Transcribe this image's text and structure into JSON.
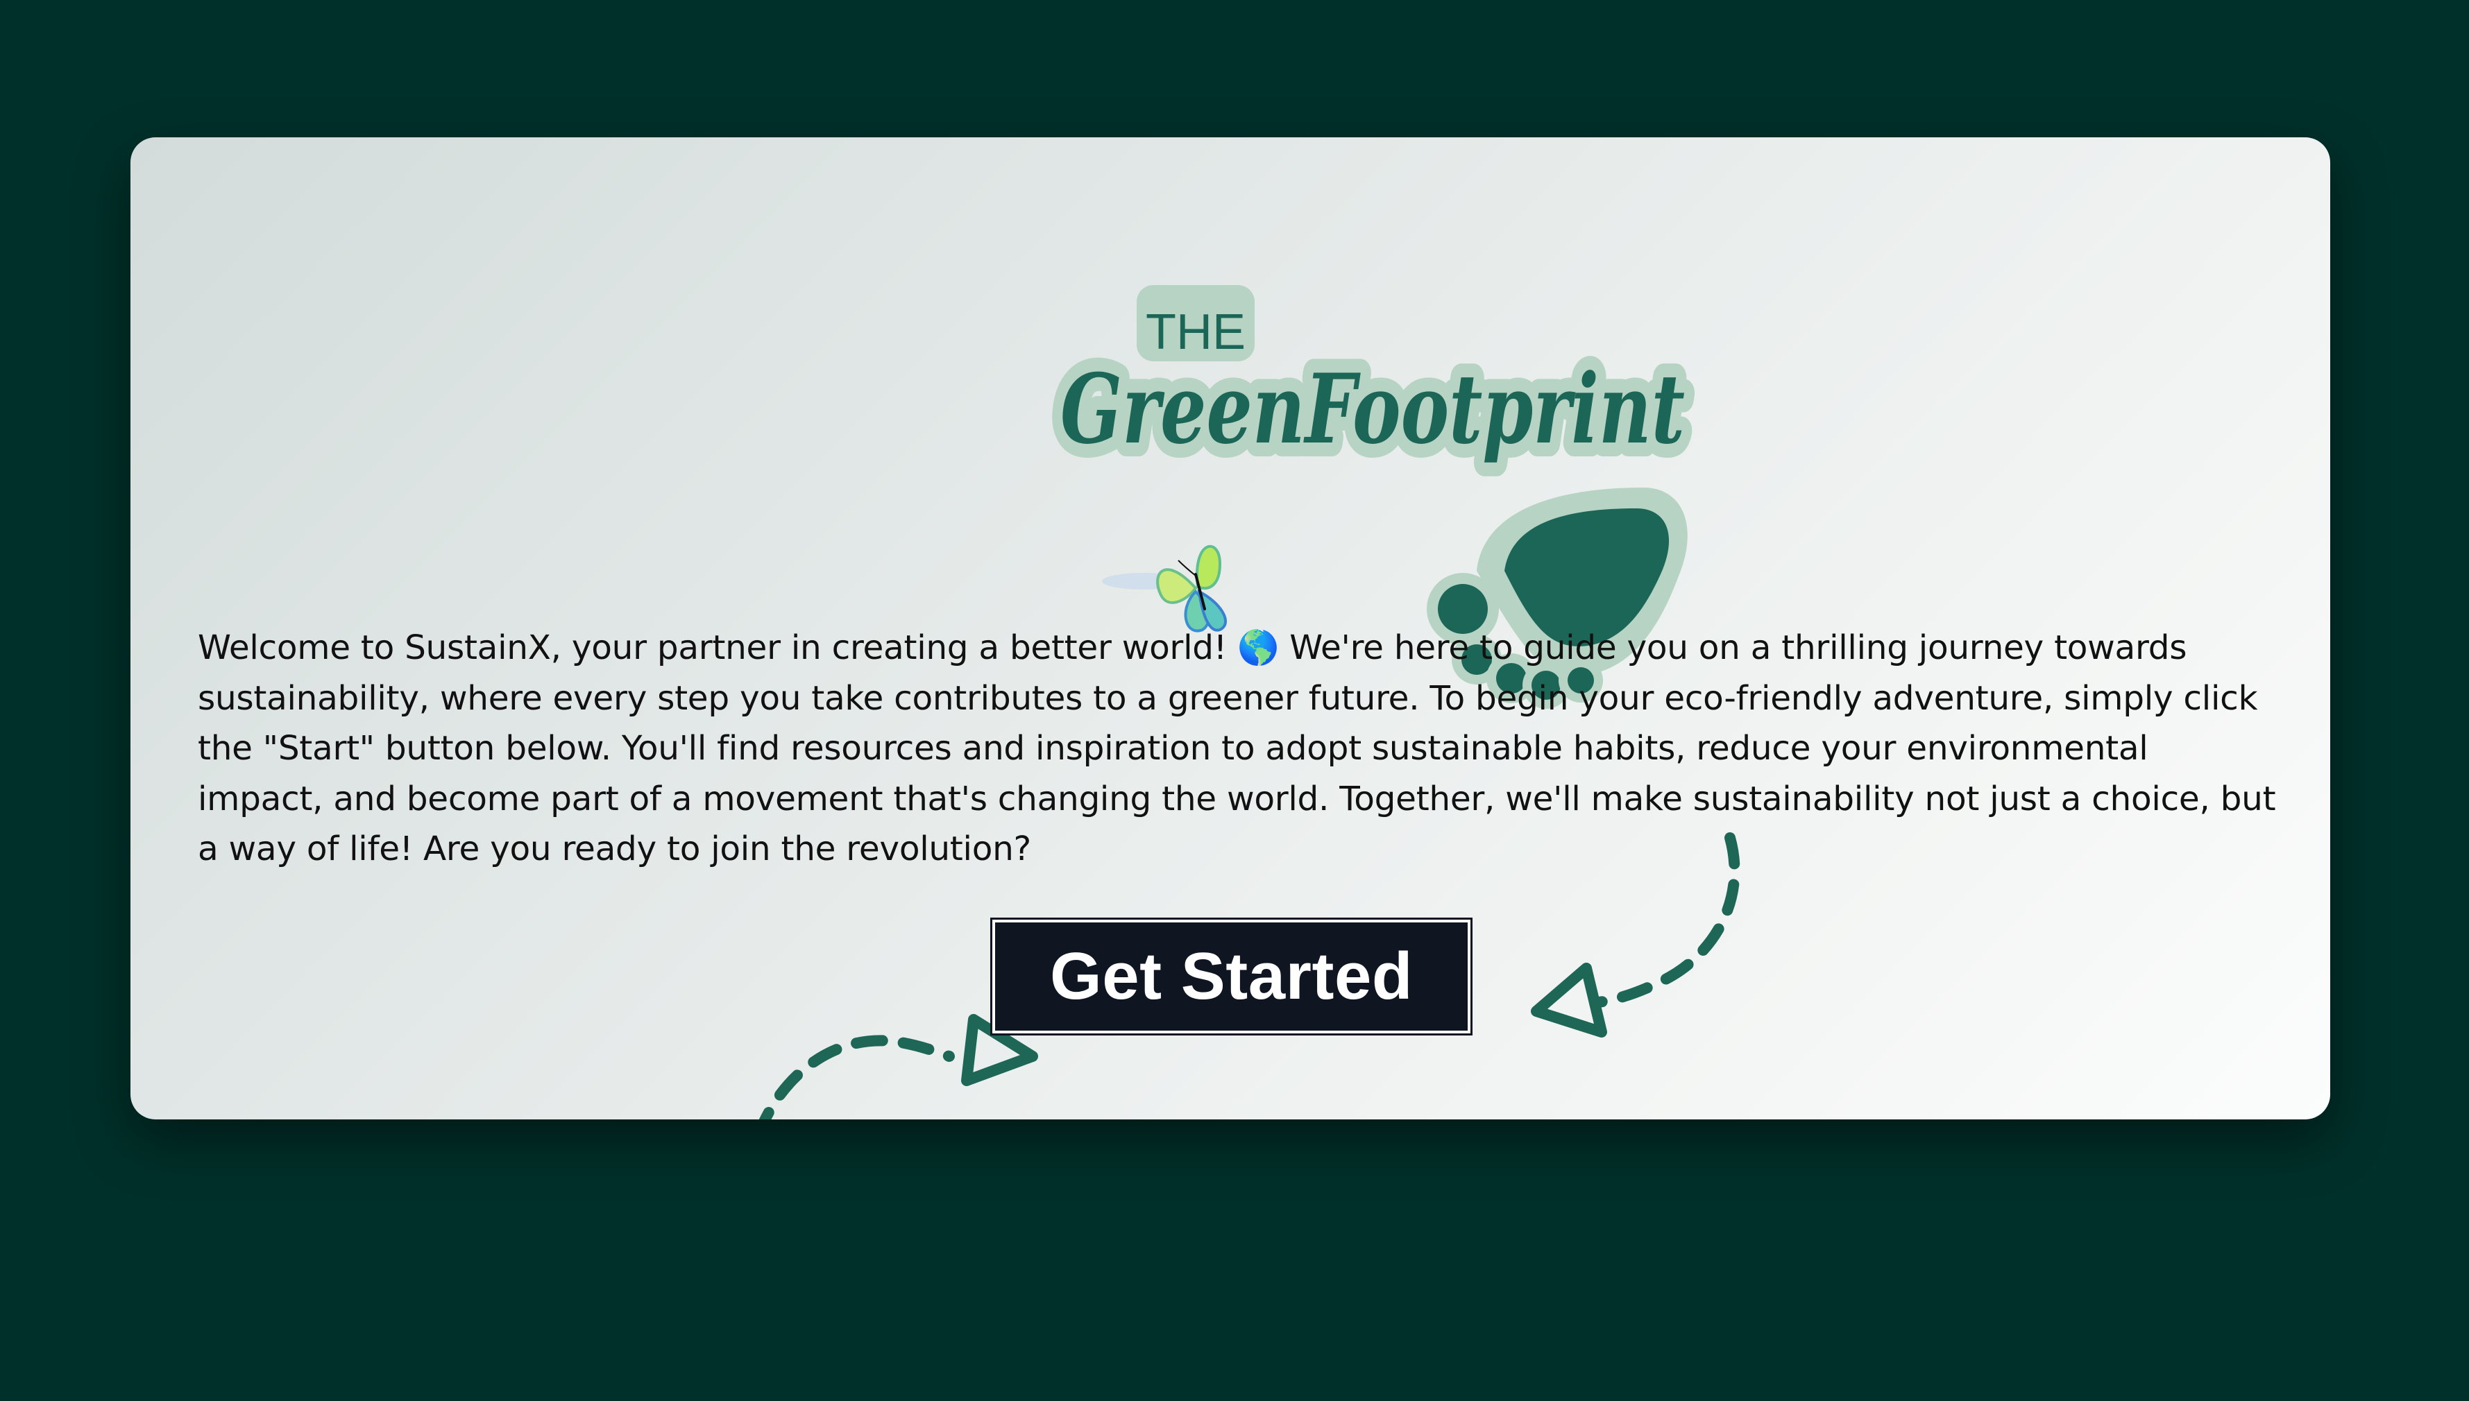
{
  "logo": {
    "top_word": "THE",
    "script_word": "GreenFootprint"
  },
  "welcome_text": "Welcome to SustainX, your partner in creating a better world! 🌎 We're here to guide you on a thrilling journey towards sustainability, where every step you take contributes to a greener future. To begin your eco-friendly adventure, simply click the \"Start\" button below. You'll find resources and inspiration to adopt sustainable habits, reduce your environmental impact, and become part of a movement that's changing the world. Together, we'll make sustainability not just a choice, but a way of life! Are you ready to join the revolution?",
  "cta": {
    "label": "Get Started"
  },
  "icons": {
    "butterfly": "butterfly-icon",
    "footprint": "footprint-icon",
    "arrows": "dashed-arrow-icon"
  },
  "colors": {
    "page_background": "#00302a",
    "brand_green": "#1b6656",
    "logo_halo": "#b7d3c4",
    "button_background": "#0f1521",
    "button_text": "#ffffff"
  }
}
